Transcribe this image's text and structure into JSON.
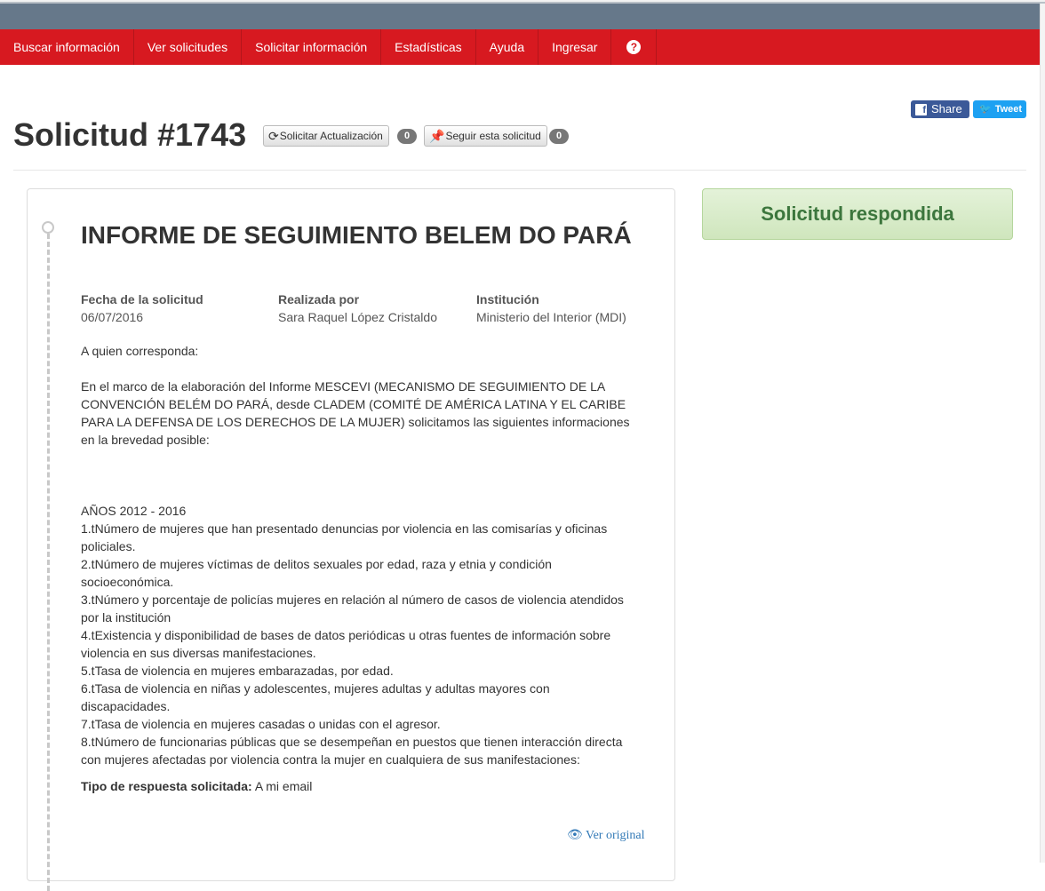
{
  "nav": {
    "items": [
      {
        "label": "Buscar información"
      },
      {
        "label": "Ver solicitudes"
      },
      {
        "label": "Solicitar información"
      },
      {
        "label": "Estadísticas"
      },
      {
        "label": "Ayuda"
      },
      {
        "label": "Ingresar"
      }
    ],
    "help_glyph": "?"
  },
  "social": {
    "share_label": "Share",
    "share_glyph": "f",
    "tweet_label": "Tweet",
    "tweet_glyph": "🐦"
  },
  "header": {
    "title": "Solicitud #1743",
    "update_button": {
      "label": "Solicitar Actualización",
      "icon": "refresh-icon",
      "glyph": "⟳",
      "count": "0"
    },
    "follow_button": {
      "label": "Seguir esta solicitud",
      "icon": "pin-icon",
      "glyph": "📌",
      "count": "0"
    }
  },
  "request": {
    "title": "INFORME DE SEGUIMIENTO BELEM DO PARÁ",
    "date_label": "Fecha de la solicitud",
    "date_value": "06/07/2016",
    "author_label": "Realizada por",
    "author_value": "Sara Raquel López Cristaldo",
    "institution_label": "Institución",
    "institution_value": "Ministerio del Interior (MDI)",
    "greeting": "A quien corresponda:",
    "intro": "En el marco de la elaboración del Informe MESCEVI (MECANISMO DE SEGUIMIENTO DE LA CONVENCIÓN BELÉM DO PARÁ, desde CLADEM (COMITÉ DE AMÉRICA LATINA Y EL CARIBE PARA LA DEFENSA DE LOS DERECHOS DE LA MUJER) solicitamos las siguientes informaciones en la brevedad posible:",
    "years": "AÑOS 2012 - 2016",
    "items": [
      "1.tNúmero de mujeres que han presentado denuncias por violencia en las comisarías y oficinas policiales.",
      "2.tNúmero de mujeres víctimas de delitos sexuales por edad, raza y etnia y condición socioeconómica.",
      "3.tNúmero y porcentaje de policías mujeres en relación al número de casos de violencia atendidos por la institución",
      "4.tExistencia y disponibilidad de bases de datos periódicas u otras fuentes de información sobre violencia en sus diversas manifestaciones.",
      "5.tTasa de violencia en mujeres embarazadas, por edad.",
      "6.tTasa de violencia en niñas y adolescentes, mujeres adultas y adultas mayores con discapacidades.",
      "7.tTasa de violencia en mujeres casadas o unidas con el agresor.",
      "8.tNúmero de funcionarias públicas que se desempeñan en puestos que tienen interacción directa con mujeres afectadas por violencia contra la mujer en cualquiera de sus manifestaciones:"
    ],
    "response_type_label": "Tipo de respuesta solicitada:",
    "response_type_value": "A mi email",
    "view_original_label": "Ver original",
    "view_original_glyph": "👁"
  },
  "status": {
    "label": "Solicitud respondida"
  },
  "colors": {
    "nav_bg": "#d71920",
    "topbar_bg": "#66788a",
    "facebook": "#3b5998",
    "twitter": "#1da1f2",
    "status_text": "#3c763d",
    "link": "#337ab7"
  }
}
